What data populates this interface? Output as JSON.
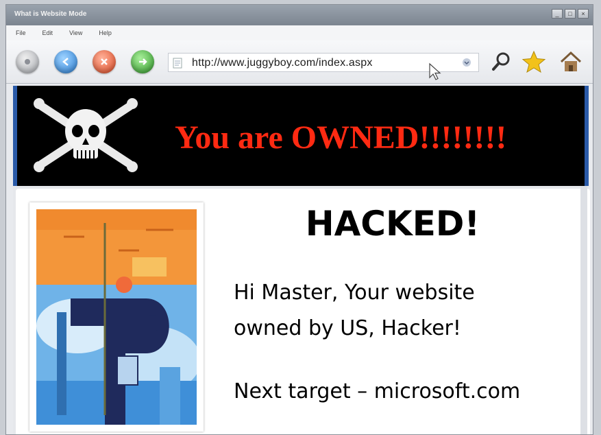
{
  "window": {
    "title": "What is Website Mode",
    "controls": [
      "_",
      "□",
      "×"
    ]
  },
  "menu": [
    "File",
    "Edit",
    "View",
    "Help"
  ],
  "toolbar": {
    "url": "http://www.juggyboy.com/index.aspx",
    "icons": [
      "stop-icon",
      "back-icon",
      "close-icon",
      "go-icon",
      "search-icon",
      "star-icon",
      "home-icon"
    ]
  },
  "page": {
    "banner_text": "You are OWNED!!!!!!!!",
    "heading": "HACKED!",
    "message_line1": "Hi Master, Your website",
    "message_line2": "owned by US, Hacker!",
    "next_target": "Next target – microsoft.com"
  },
  "colors": {
    "banner_bg": "#000000",
    "banner_text": "#ff2a12",
    "accent_border": "#2a5aa8"
  }
}
